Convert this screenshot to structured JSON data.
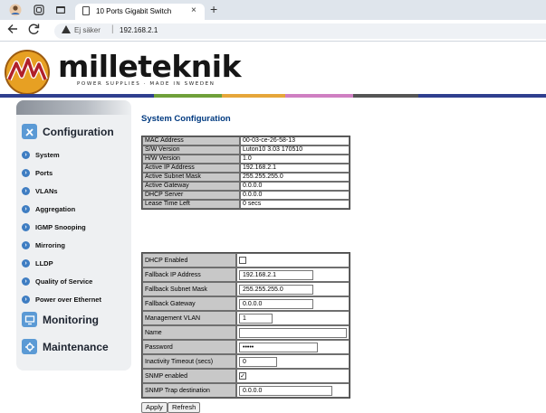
{
  "browser": {
    "tab_title": "10 Ports Gigabit Switch",
    "close_glyph": "×",
    "new_tab_glyph": "+",
    "security_text": "Ej säker",
    "url": "192.168.2.1"
  },
  "brand": {
    "name": "milleteknik",
    "tagline": "POWER SUPPLIES · MADE IN SWEDEN",
    "band_colors": [
      "#2f3f8f",
      "#2f3f8f",
      "#6fa03a",
      "#e6a63a",
      "#cf7fc2",
      "#555555",
      "#2f3f8f"
    ]
  },
  "sidebar": {
    "configuration": "Configuration",
    "items": [
      "System",
      "Ports",
      "VLANs",
      "Aggregation",
      "IGMP Snooping",
      "Mirroring",
      "LLDP",
      "Quality of Service",
      "Power over Ethernet"
    ],
    "monitoring": "Monitoring",
    "maintenance": "Maintenance"
  },
  "main": {
    "title": "System Configuration",
    "info": [
      {
        "label": "MAC Address",
        "value": "00-03-ce-26-58-13"
      },
      {
        "label": "S/W Version",
        "value": "Luton10 3.03 170510"
      },
      {
        "label": "H/W Version",
        "value": "1.0"
      },
      {
        "label": "Active IP Address",
        "value": "192.168.2.1"
      },
      {
        "label": "Active Subnet Mask",
        "value": "255.255.255.0"
      },
      {
        "label": "Active Gateway",
        "value": "0.0.0.0"
      },
      {
        "label": "DHCP Server",
        "value": "0.0.0.0"
      },
      {
        "label": "Lease Time Left",
        "value": "0 secs"
      }
    ],
    "config": {
      "dhcp_label": "DHCP Enabled",
      "dhcp_checked": false,
      "ip_label": "Fallback IP Address",
      "ip_value": "192.168.2.1",
      "mask_label": "Fallback Subnet Mask",
      "mask_value": "255.255.255.0",
      "gw_label": "Fallback Gateway",
      "gw_value": "0.0.0.0",
      "vlan_label": "Management VLAN",
      "vlan_value": "1",
      "name_label": "Name",
      "name_value": "",
      "pass_label": "Password",
      "pass_value": "•••••",
      "timeout_label": "Inactivity Timeout (secs)",
      "timeout_value": "0",
      "snmp_label": "SNMP enabled",
      "snmp_checked": true,
      "check_glyph": "✓",
      "trap_label": "SNMP Trap destination",
      "trap_value": "0.0.0.0"
    },
    "apply": "Apply",
    "refresh": "Refresh"
  }
}
